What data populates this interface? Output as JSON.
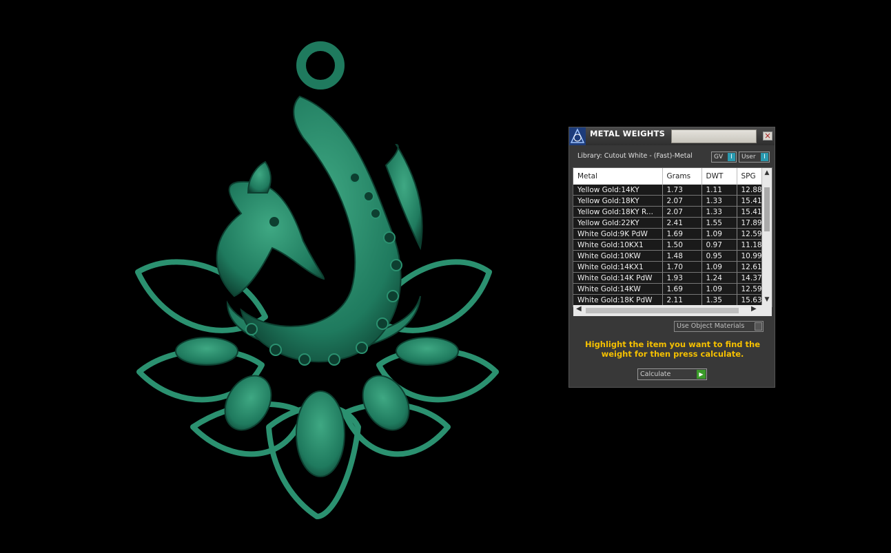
{
  "colors": {
    "pendant": "#1f7a5e",
    "pendant_dark": "#0d3f30",
    "pendant_light": "#3fa883",
    "hint": "#f5c000",
    "toggle_on": "#2a9ab0",
    "calc_play": "#3b9b2a"
  },
  "panel": {
    "title": "METAL WEIGHTS",
    "close_glyph": "×",
    "library": "Library: Cutout White - (Fast)-Metal",
    "toggles": [
      {
        "label": "GV",
        "state": "I"
      },
      {
        "label": "User",
        "state": "I"
      }
    ],
    "table": {
      "columns": [
        "Metal",
        "Grams",
        "DWT",
        "SPG"
      ],
      "rows": [
        [
          "Yellow Gold:14KY",
          "1.73",
          "1.11",
          "12.88"
        ],
        [
          "Yellow Gold:18KY",
          "2.07",
          "1.33",
          "15.41"
        ],
        [
          "Yellow Gold:18KY R...",
          "2.07",
          "1.33",
          "15.41"
        ],
        [
          "Yellow Gold:22KY",
          "2.41",
          "1.55",
          "17.89"
        ],
        [
          "White Gold:9K PdW",
          "1.69",
          "1.09",
          "12.59"
        ],
        [
          "White Gold:10KX1",
          "1.50",
          "0.97",
          "11.18"
        ],
        [
          "White Gold:10KW",
          "1.48",
          "0.95",
          "10.99"
        ],
        [
          "White Gold:14KX1",
          "1.70",
          "1.09",
          "12.61"
        ],
        [
          "White Gold:14K PdW",
          "1.93",
          "1.24",
          "14.37"
        ],
        [
          "White Gold:14KW",
          "1.69",
          "1.09",
          "12.59"
        ],
        [
          "White Gold:18K PdW",
          "2.11",
          "1.35",
          "15.63"
        ]
      ]
    },
    "use_object_materials": "Use Object Materials",
    "hint": "Highlight the item you want to find the weight for then press calculate.",
    "calculate_label": "Calculate",
    "calculate_icon": "play-icon"
  }
}
